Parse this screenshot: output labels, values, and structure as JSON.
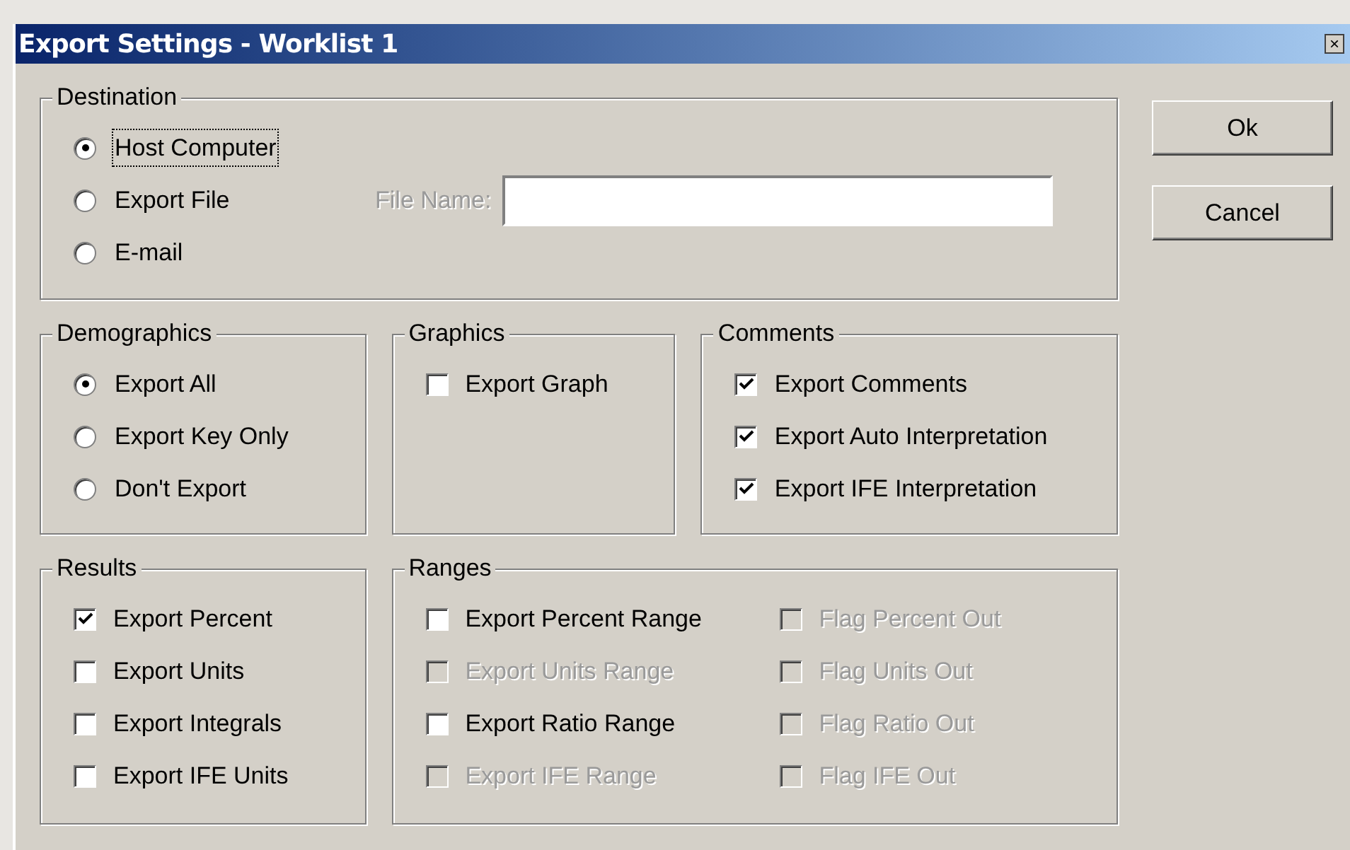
{
  "window": {
    "title": "Export Settings - Worklist 1",
    "close": "×"
  },
  "destination": {
    "title": "Destination",
    "options": [
      {
        "label": "Host Computer",
        "selected": true,
        "focused": true
      },
      {
        "label": "Export File",
        "selected": false,
        "focused": false
      },
      {
        "label": "E-mail",
        "selected": false,
        "focused": false
      }
    ],
    "file_name": {
      "label": "File Name:",
      "disabled": true
    }
  },
  "demographics": {
    "title": "Demographics",
    "options": [
      {
        "label": "Export All",
        "selected": true
      },
      {
        "label": "Export Key Only",
        "selected": false
      },
      {
        "label": "Don't Export",
        "selected": false
      }
    ]
  },
  "graphics": {
    "title": "Graphics",
    "items": [
      {
        "label": "Export Graph",
        "checked": false,
        "disabled": false
      }
    ]
  },
  "comments": {
    "title": "Comments",
    "items": [
      {
        "label": "Export Comments",
        "checked": true,
        "disabled": false
      },
      {
        "label": "Export Auto Interpretation",
        "checked": true,
        "disabled": false
      },
      {
        "label": "Export IFE Interpretation",
        "checked": true,
        "disabled": false
      }
    ]
  },
  "results": {
    "title": "Results",
    "items": [
      {
        "label": "Export Percent",
        "checked": true,
        "disabled": false
      },
      {
        "label": "Export Units",
        "checked": false,
        "disabled": false
      },
      {
        "label": "Export Integrals",
        "checked": false,
        "disabled": false
      },
      {
        "label": "Export IFE Units",
        "checked": false,
        "disabled": false
      }
    ]
  },
  "ranges": {
    "title": "Ranges",
    "items": [
      {
        "label": "Export Percent Range",
        "checked": false,
        "disabled": false
      },
      {
        "label": "Flag Percent Out",
        "checked": false,
        "disabled": true
      },
      {
        "label": "Export Units Range",
        "checked": false,
        "disabled": true
      },
      {
        "label": "Flag Units Out",
        "checked": false,
        "disabled": true
      },
      {
        "label": "Export Ratio Range",
        "checked": false,
        "disabled": false
      },
      {
        "label": "Flag Ratio Out",
        "checked": false,
        "disabled": true
      },
      {
        "label": "Export IFE Range",
        "checked": false,
        "disabled": true
      },
      {
        "label": "Flag IFE Out",
        "checked": false,
        "disabled": true
      }
    ]
  },
  "buttons": [
    {
      "label": "Ok"
    },
    {
      "label": "Cancel"
    }
  ]
}
